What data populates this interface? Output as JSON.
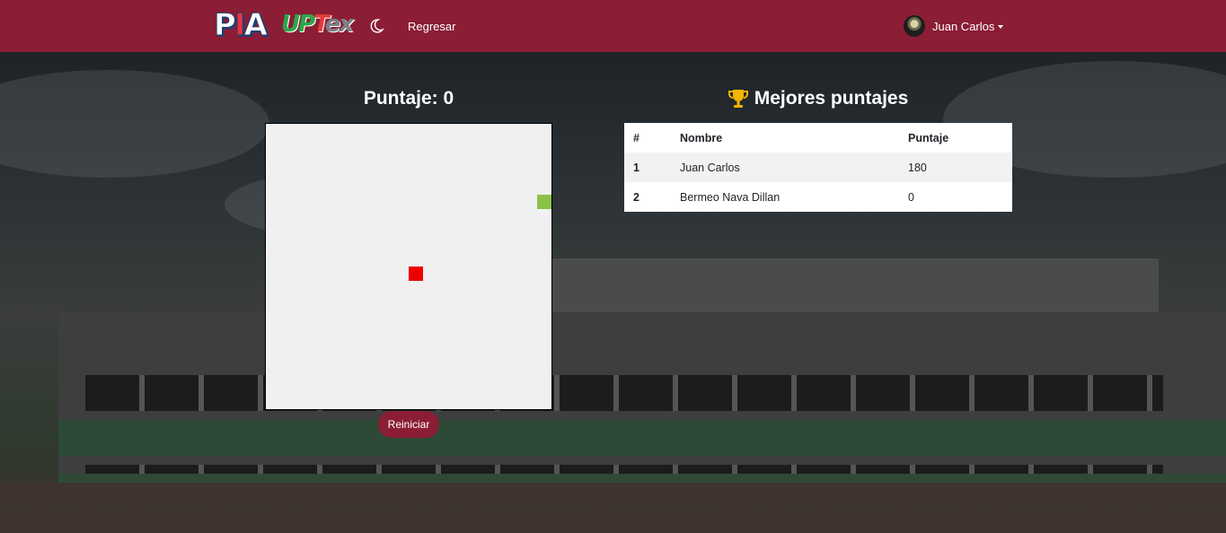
{
  "navbar": {
    "logo_pia": "PIA",
    "logo_uptex": "UPTex",
    "theme_toggle_icon": "moon-icon",
    "back_link": "Regresar",
    "user_name": "Juan Carlos",
    "accent_color": "#8b1d35"
  },
  "game": {
    "score_label": "Puntaje: 0",
    "restart_label": "Reiniciar",
    "board_color": "#f0f0f0",
    "food_color": "#ee0000",
    "snake_color": "#8bc34a"
  },
  "leaderboard": {
    "title": "Mejores puntajes",
    "title_icon": "trophy-icon",
    "headers": [
      "#",
      "Nombre",
      "Puntaje"
    ],
    "rows": [
      {
        "rank": "1",
        "name": "Juan Carlos",
        "score": "180"
      },
      {
        "rank": "2",
        "name": "Bermeo Nava Dillan",
        "score": "0"
      }
    ]
  }
}
